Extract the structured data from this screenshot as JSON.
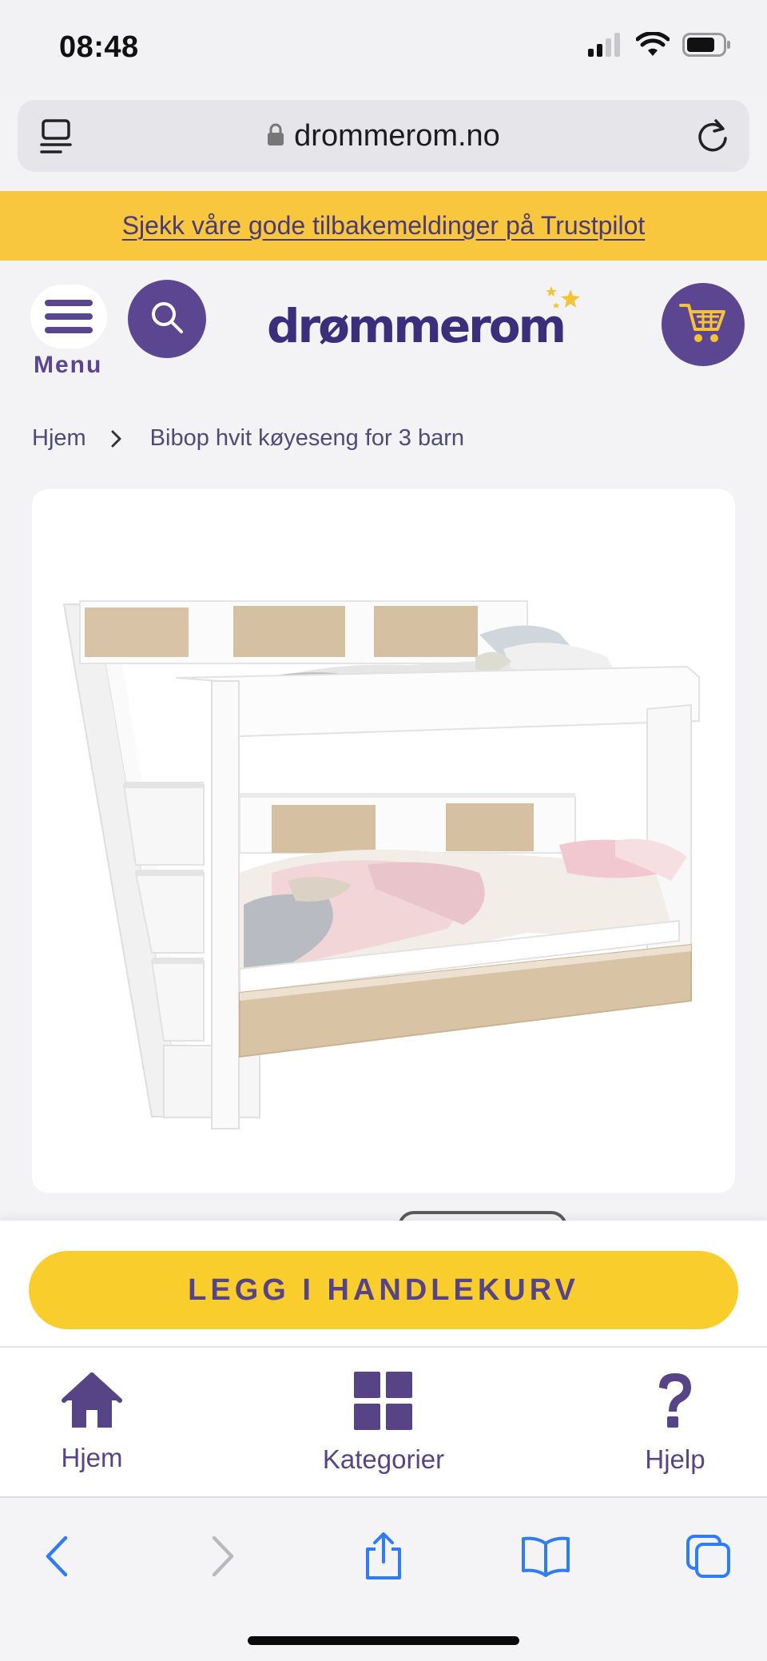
{
  "status_bar": {
    "time": "08:48",
    "icons": [
      "cellular-signal-icon",
      "wifi-icon",
      "battery-icon"
    ]
  },
  "browser": {
    "url": "drommerom.no",
    "icons": [
      "reader-mode-icon",
      "lock-icon",
      "reload-icon"
    ]
  },
  "banner": {
    "text": "Sjekk våre gode tilbakemeldinger på Trustpilot",
    "background": "#f8c73e"
  },
  "header": {
    "menu_label": "Menu",
    "logo_text": "drømmerom",
    "brand_color": "#5c4591",
    "icons": [
      "hamburger-icon",
      "search-icon",
      "cart-icon"
    ]
  },
  "breadcrumb": {
    "items": [
      "Hjem",
      "Bibop hvit køyeseng for 3 barn"
    ]
  },
  "product": {
    "image_alt": "Bibop white bunk bed with stairs and pull-out bed"
  },
  "cta": {
    "label": "LEGG I HANDLEKURV",
    "color": "#f9cd2c"
  },
  "bottom_nav": {
    "items": [
      {
        "label": "Hjem",
        "icon": "home-icon"
      },
      {
        "label": "Kategorier",
        "icon": "grid-icon"
      },
      {
        "label": "Hjelp",
        "icon": "question-icon"
      }
    ]
  },
  "safari_toolbar": {
    "icons": [
      "back-icon",
      "forward-icon",
      "share-icon",
      "bookmarks-icon",
      "tabs-icon"
    ],
    "accent": "#2f7cf6"
  }
}
